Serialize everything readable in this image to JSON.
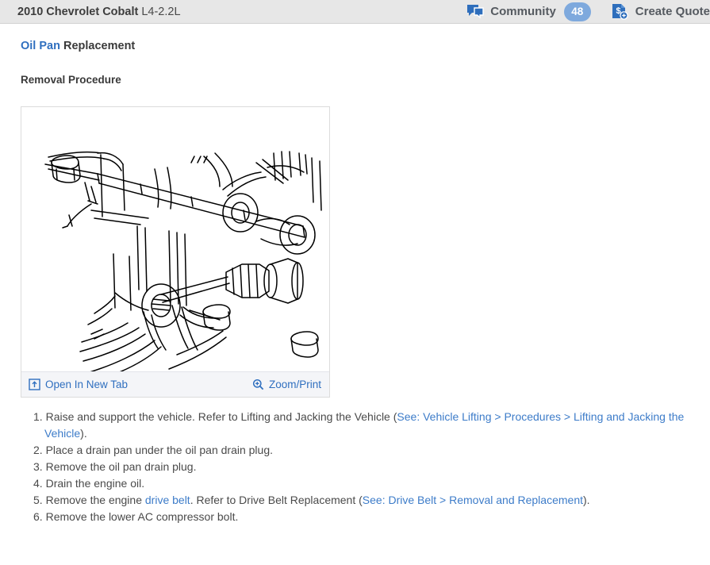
{
  "header": {
    "vehicle_model": "2010 Chevrolet Cobalt",
    "vehicle_engine": " L4-2.2L",
    "community_label": "Community",
    "community_count": "48",
    "create_quote_label": "Create Quote",
    "icons": {
      "community": "chat-bubble-icon",
      "create_quote": "quote-document-icon"
    }
  },
  "document": {
    "part_name": "Oil Pan",
    "title_suffix": " Replacement",
    "section_title": "Removal Procedure"
  },
  "figure": {
    "alt": "oil-pan-diagram",
    "open_new_tab_label": "Open In New Tab",
    "zoom_print_label": "Zoom/Print",
    "open_new_tab_icon": "open-in-new-tab-icon",
    "zoom_print_icon": "magnifier-plus-icon"
  },
  "steps": [
    {
      "num": "1.",
      "parts": [
        {
          "type": "text",
          "text": " Raise and support the vehicle. Refer to Lifting and Jacking the Vehicle ("
        },
        {
          "type": "link",
          "text": "See: Vehicle Lifting > Procedures > Lifting and Jacking the Vehicle"
        },
        {
          "type": "text",
          "text": ")."
        }
      ]
    },
    {
      "num": "2.",
      "parts": [
        {
          "type": "text",
          "text": " Place a drain pan under the oil pan drain plug."
        }
      ]
    },
    {
      "num": "3.",
      "parts": [
        {
          "type": "text",
          "text": " Remove the oil pan drain plug."
        }
      ]
    },
    {
      "num": "4.",
      "parts": [
        {
          "type": "text",
          "text": " Drain the engine oil."
        }
      ]
    },
    {
      "num": "5.",
      "parts": [
        {
          "type": "text",
          "text": " Remove the engine "
        },
        {
          "type": "link",
          "text": "drive belt"
        },
        {
          "type": "text",
          "text": ". Refer to Drive Belt Replacement ("
        },
        {
          "type": "link",
          "text": "See: Drive Belt > Removal and Replacement"
        },
        {
          "type": "text",
          "text": ")."
        }
      ]
    },
    {
      "num": "6.",
      "parts": [
        {
          "type": "text",
          "text": " Remove the lower AC compressor bolt."
        }
      ]
    }
  ],
  "colors": {
    "link": "#3d7cc9",
    "part_link": "#2f6fbf",
    "header_bg": "#e7e7e7",
    "badge_bg": "#7ea9dd",
    "icon_blue": "#2e6ebc",
    "figure_footer_bg": "#f4f5f8"
  }
}
